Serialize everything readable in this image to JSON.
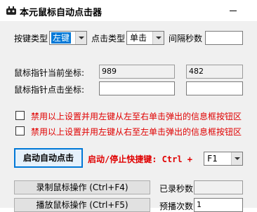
{
  "window": {
    "title": "本元鼠标自动点击器"
  },
  "settings": {
    "key_type_label": "按键类型",
    "key_type_value": "左键",
    "click_type_label": "点击类型",
    "click_type_value": "单击",
    "interval_label": "间隔秒数",
    "interval_value": ""
  },
  "pointer": {
    "current_label": "鼠标指针当前坐标:",
    "current_x": "989",
    "current_y": "482",
    "click_label": "鼠标指针点击坐标:",
    "click_x": "",
    "click_y": ""
  },
  "options": {
    "disable_left_to_right": "禁用以上设置并用左键从左至右单击弹出的信息框按钮区",
    "disable_right_to_left": "禁用以上设置并用左键从右至左单击弹出的信息框按钮区"
  },
  "controls": {
    "start_button": "启动自动点击",
    "hotkey_label": "启动/停止快捷键: Ctrl +",
    "hotkey_value": "F1",
    "record_button": "录制鼠标操作 (Ctrl+F4)",
    "recorded_seconds_label": "已录秒数",
    "recorded_seconds_value": "",
    "play_button": "播放鼠标操作 (Ctrl+F5)",
    "play_count_label": "预播次数",
    "play_count_value": "1"
  },
  "colors": {
    "accent": "#0078d7",
    "warning_text": "#e00000"
  }
}
